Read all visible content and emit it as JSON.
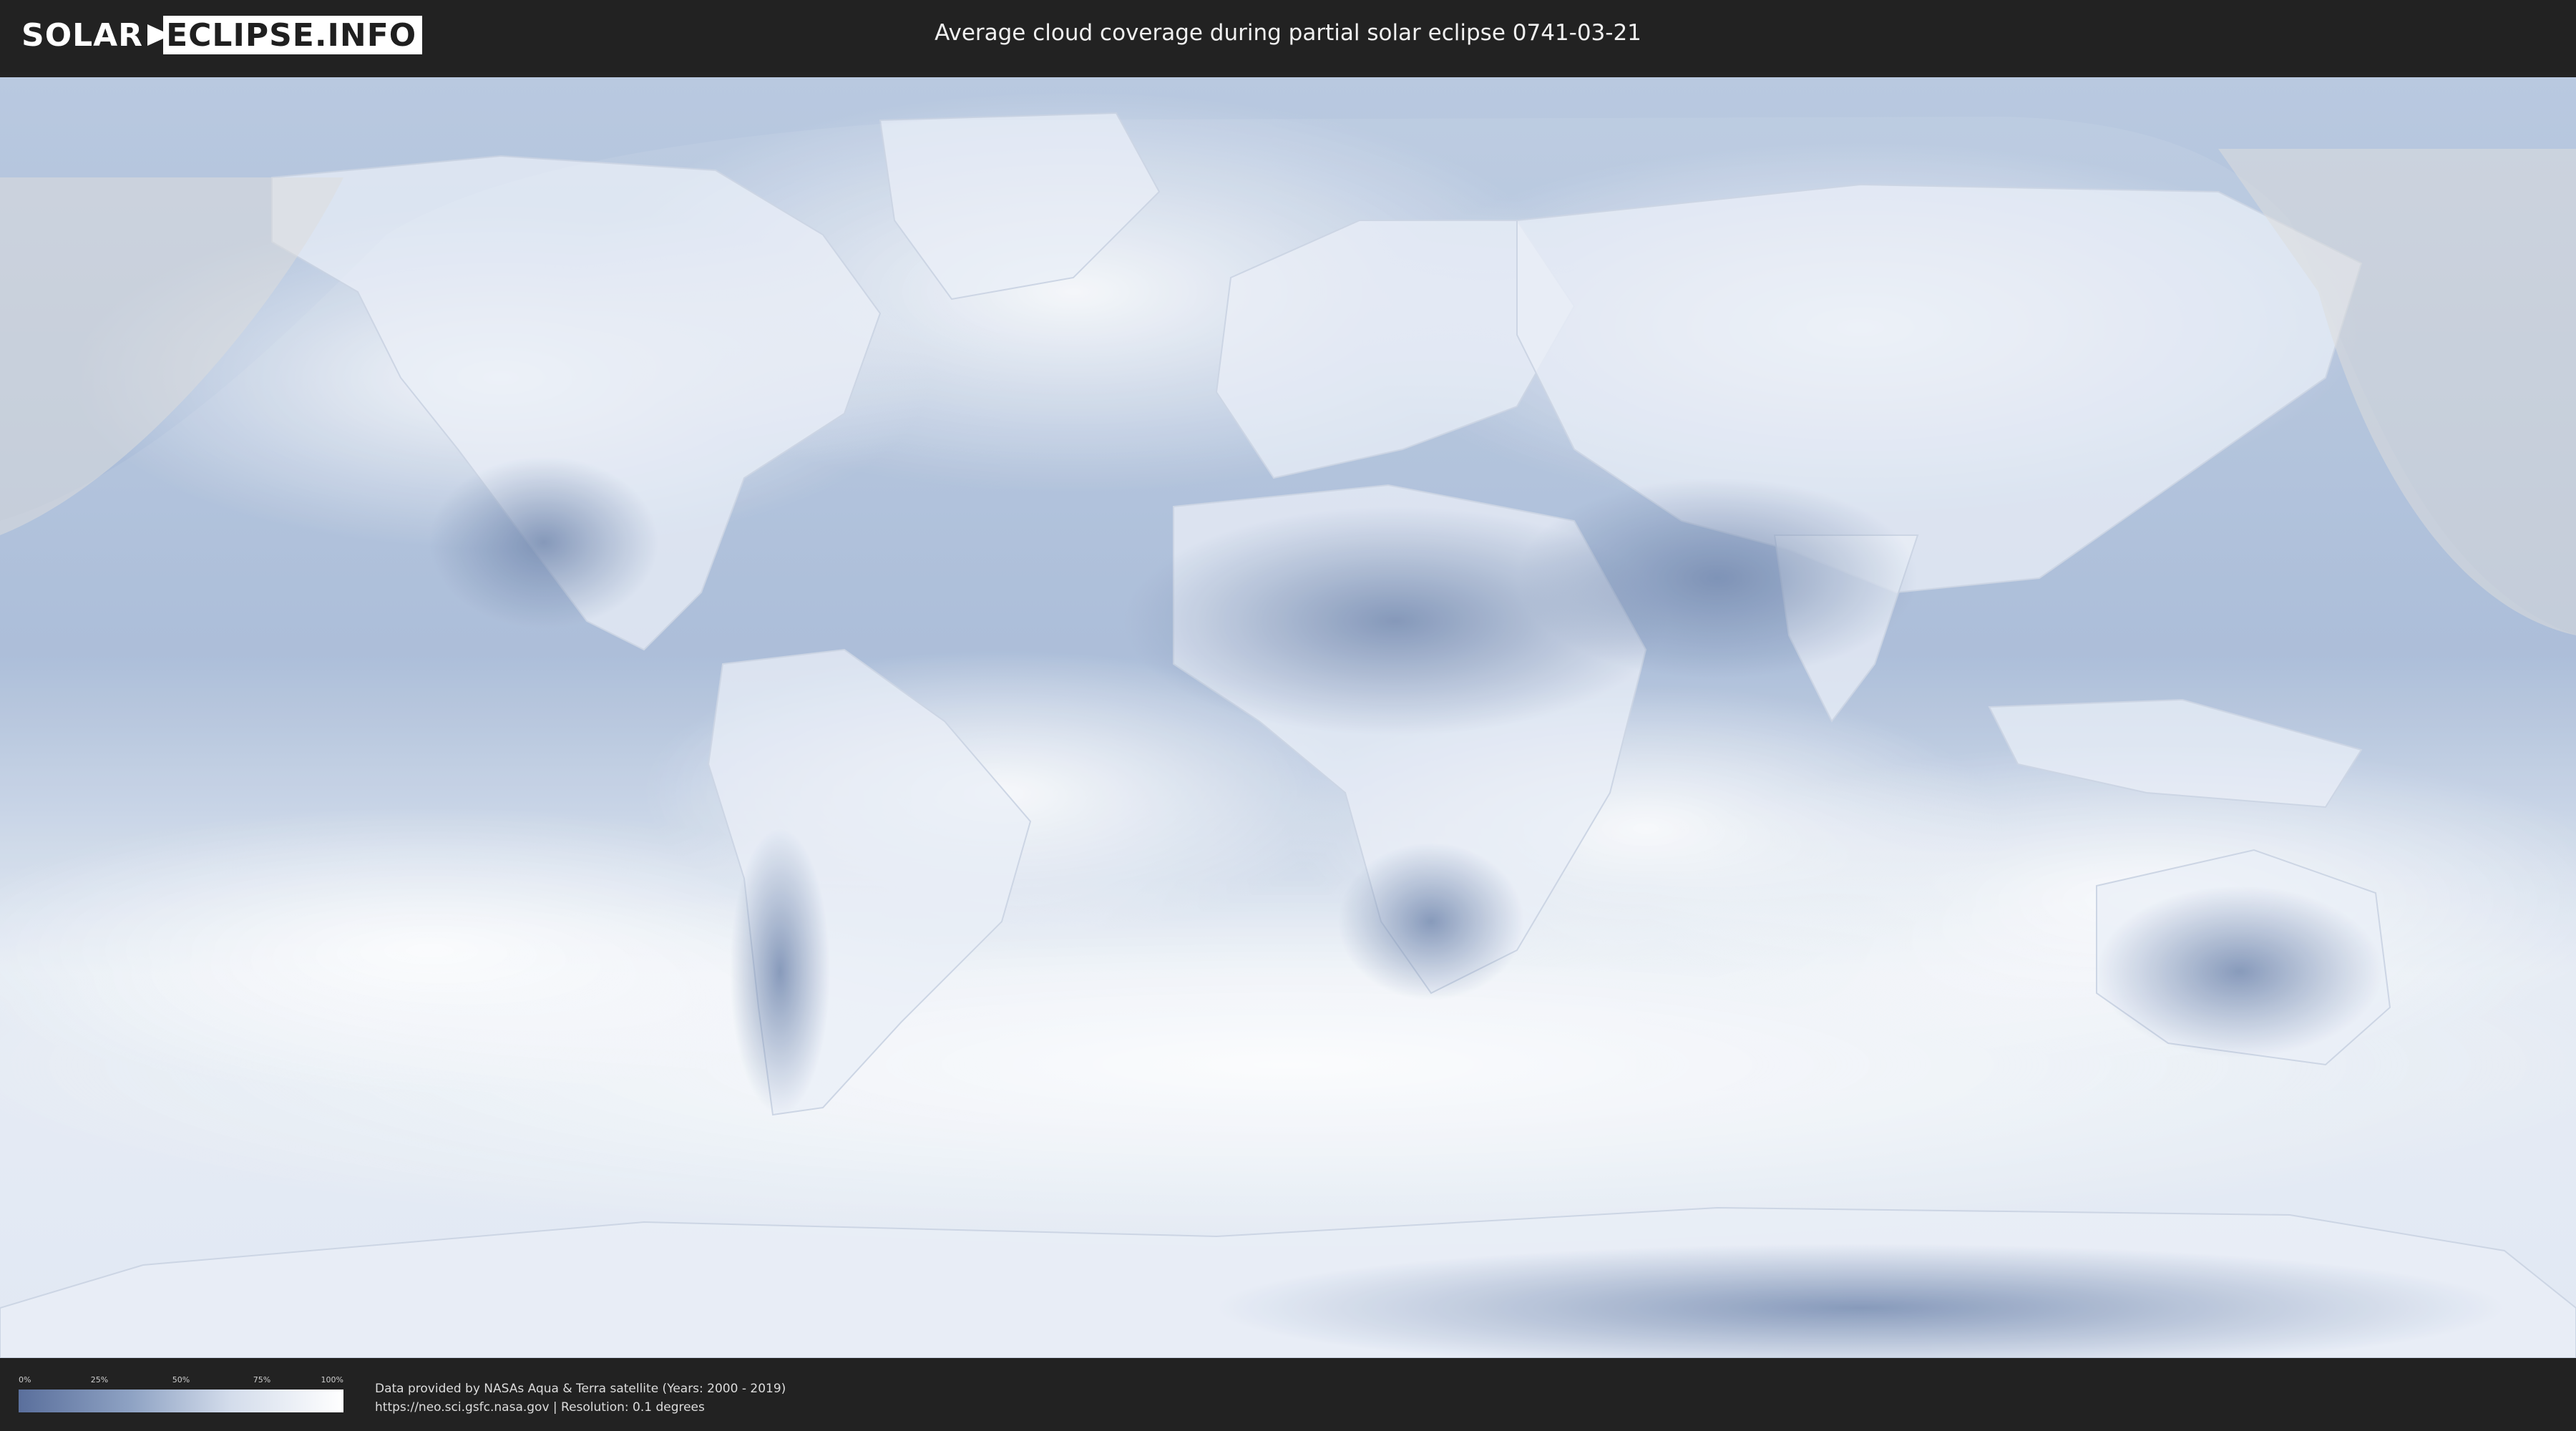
{
  "header": {
    "logo_left": "SOLAR",
    "logo_right": "ECLIPSE.INFO",
    "title": "Average cloud coverage during partial solar eclipse 0741-03-21"
  },
  "legend": {
    "ticks": [
      "0%",
      "25%",
      "50%",
      "75%",
      "100%"
    ],
    "colors": {
      "low": "#5a6f9c",
      "high": "#ffffff"
    }
  },
  "credits": {
    "line1": "Data provided by NASAs Aqua & Terra satellite (Years: 2000 - 2019)",
    "line2": "https://neo.sci.gsfc.nasa.gov | Resolution: 0.1 degrees"
  },
  "map": {
    "ocean_color": "#a9bcd8",
    "land_clear_color": "#6f86ad",
    "cloud_color": "#f2f5fa"
  }
}
